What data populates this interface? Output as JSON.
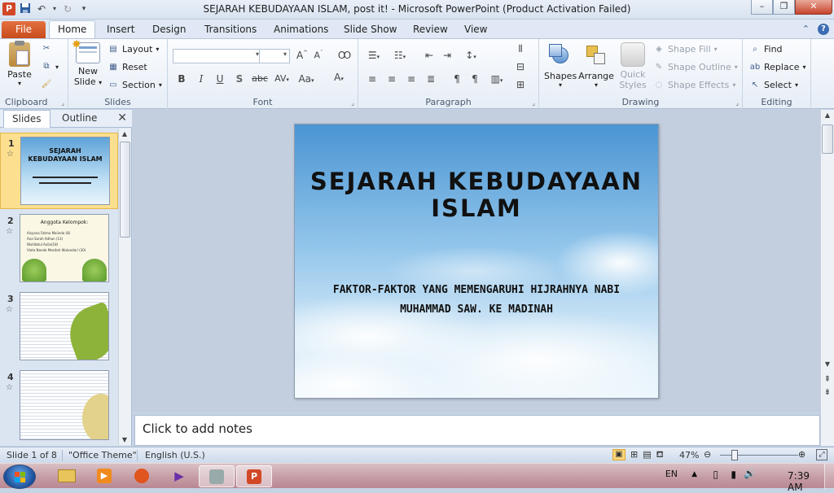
{
  "window": {
    "title": "SEJARAH KEBUDAYAAN ISLAM, post it!  -  Microsoft PowerPoint (Product Activation Failed)",
    "app_icon_label": "P",
    "qat": [
      "save-icon",
      "undo-icon",
      "redo-icon",
      "customize-icon"
    ]
  },
  "tabs": {
    "file": "File",
    "items": [
      "Home",
      "Insert",
      "Design",
      "Transitions",
      "Animations",
      "Slide Show",
      "Review",
      "View"
    ],
    "active": "Home"
  },
  "ribbon": {
    "clipboard": {
      "label": "Clipboard",
      "paste": "Paste"
    },
    "slides": {
      "label": "Slides",
      "new_slide": "New",
      "new_slide2": "Slide",
      "layout": "Layout",
      "reset": "Reset",
      "section": "Section"
    },
    "font": {
      "label": "Font"
    },
    "paragraph": {
      "label": "Paragraph"
    },
    "drawing": {
      "label": "Drawing",
      "shapes": "Shapes",
      "arrange": "Arrange",
      "quick_styles": "Quick",
      "quick_styles2": "Styles",
      "shape_fill": "Shape Fill",
      "shape_outline": "Shape Outline",
      "shape_effects": "Shape Effects"
    },
    "editing": {
      "label": "Editing",
      "find": "Find",
      "replace": "Replace",
      "select": "Select"
    }
  },
  "left_pane": {
    "tabs": [
      "Slides",
      "Outline"
    ],
    "thumbs": [
      {
        "num": "1",
        "title": "SEJARAH KEBUDAYAAN ISLAM"
      },
      {
        "num": "2",
        "title": "Anggota Kelompok:",
        "lines": [
          "Aisyana Fatma Malinda (8)",
          "Ana Sarah Adhan (13)",
          "Wulidatul Aulia(18)",
          "Viota Nanda Masitoh Wulandari (30)"
        ]
      },
      {
        "num": "3"
      },
      {
        "num": "4"
      }
    ]
  },
  "slide": {
    "title": "SEJARAH KEBUDAYAAN ISLAM",
    "subtitle_line1": "FAKTOR-FAKTOR YANG MEMENGARUHI HIJRAHNYA NABI",
    "subtitle_line2": "MUHAMMAD SAW. KE MADINAH"
  },
  "notes": {
    "placeholder": "Click to add notes"
  },
  "status": {
    "slide_info": "Slide 1 of 8",
    "theme": "\"Office Theme\"",
    "language": "English (U.S.)",
    "zoom": "47%"
  },
  "taskbar": {
    "lang": "EN",
    "time": "7:39 AM"
  },
  "colors": {
    "file_tab": "#d04f1e",
    "selected_thumb": "#fcdf8f",
    "close_button": "#c7432b"
  }
}
